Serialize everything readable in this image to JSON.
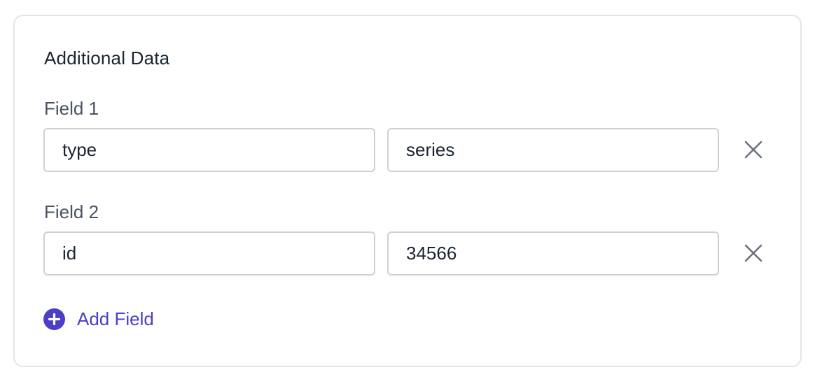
{
  "section": {
    "title": "Additional Data"
  },
  "fields": [
    {
      "label": "Field 1",
      "key": "type",
      "value": "series"
    },
    {
      "label": "Field 2",
      "key": "id",
      "value": "34566"
    }
  ],
  "add_field": {
    "label": "Add Field"
  },
  "icons": {
    "remove": "close-icon",
    "add": "plus-circle-icon"
  },
  "colors": {
    "accent": "#4b3fc8",
    "border": "#cdd1d6",
    "text": "#1b2430",
    "muted_text": "#4a5361",
    "icon_gray": "#6b727d"
  }
}
